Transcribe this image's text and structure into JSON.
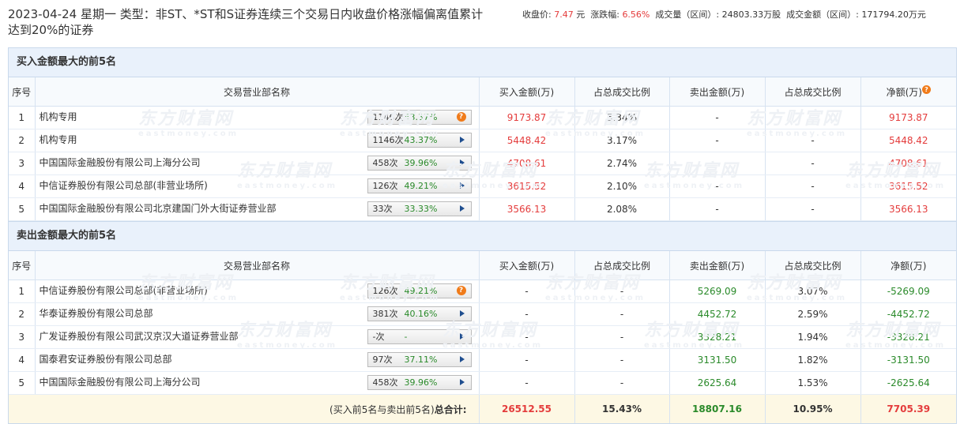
{
  "header": {
    "title": "2023-04-24 星期一 类型：非ST、*ST和S证券连续三个交易日内收盘价格涨幅偏离值累计达到20%的证券",
    "quote": {
      "close_label": "收盘价:",
      "close_value": "7.47",
      "close_unit": "元",
      "change_label": "涨跌幅:",
      "change_value": "6.56%",
      "volume_label": "成交量（区间）:",
      "volume_value": "24803.33万股",
      "amount_label": "成交金额（区间）:",
      "amount_value": "171794.20万元"
    }
  },
  "watermark": {
    "cn": "东方财富网",
    "en": "eastmoney.com"
  },
  "columns": [
    "序号",
    "交易营业部名称",
    "买入金额(万)",
    "占总成交比例",
    "卖出金额(万)",
    "占总成交比例",
    "净额(万)"
  ],
  "buy": {
    "title": "买入金额最大的前5名",
    "rows": [
      {
        "idx": "1",
        "name": "机构专用",
        "count": "1146次",
        "rate": "43.37%",
        "buy": "9173.87",
        "buy_pct": "5.34%",
        "sell": "-",
        "sell_pct": "-",
        "net": "9173.87"
      },
      {
        "idx": "2",
        "name": "机构专用",
        "count": "1146次",
        "rate": "43.37%",
        "buy": "5448.42",
        "buy_pct": "3.17%",
        "sell": "-",
        "sell_pct": "-",
        "net": "5448.42"
      },
      {
        "idx": "3",
        "name": "中国国际金融股份有限公司上海分公司",
        "count": "458次",
        "rate": "39.96%",
        "buy": "4708.61",
        "buy_pct": "2.74%",
        "sell": "-",
        "sell_pct": "-",
        "net": "4708.61"
      },
      {
        "idx": "4",
        "name": "中信证券股份有限公司总部(非营业场所)",
        "count": "126次",
        "rate": "49.21%",
        "buy": "3615.52",
        "buy_pct": "2.10%",
        "sell": "-",
        "sell_pct": "-",
        "net": "3615.52"
      },
      {
        "idx": "5",
        "name": "中国国际金融股份有限公司北京建国门外大街证券营业部",
        "count": "33次",
        "rate": "33.33%",
        "buy": "3566.13",
        "buy_pct": "2.08%",
        "sell": "-",
        "sell_pct": "-",
        "net": "3566.13"
      }
    ]
  },
  "sell": {
    "title": "卖出金额最大的前5名",
    "rows": [
      {
        "idx": "1",
        "name": "中信证券股份有限公司总部(非营业场所)",
        "count": "126次",
        "rate": "49.21%",
        "buy": "-",
        "buy_pct": "-",
        "sell": "5269.09",
        "sell_pct": "3.07%",
        "net": "-5269.09"
      },
      {
        "idx": "2",
        "name": "华泰证券股份有限公司总部",
        "count": "381次",
        "rate": "40.16%",
        "buy": "-",
        "buy_pct": "-",
        "sell": "4452.72",
        "sell_pct": "2.59%",
        "net": "-4452.72"
      },
      {
        "idx": "3",
        "name": "广发证券股份有限公司武汉京汉大道证券营业部",
        "count": "-次",
        "rate": "-",
        "buy": "-",
        "buy_pct": "-",
        "sell": "3328.21",
        "sell_pct": "1.94%",
        "net": "-3328.21"
      },
      {
        "idx": "4",
        "name": "国泰君安证券股份有限公司总部",
        "count": "97次",
        "rate": "37.11%",
        "buy": "-",
        "buy_pct": "-",
        "sell": "3131.50",
        "sell_pct": "1.82%",
        "net": "-3131.50"
      },
      {
        "idx": "5",
        "name": "中国国际金融股份有限公司上海分公司",
        "count": "458次",
        "rate": "39.96%",
        "buy": "-",
        "buy_pct": "-",
        "sell": "2625.64",
        "sell_pct": "1.53%",
        "net": "-2625.64"
      }
    ]
  },
  "total": {
    "label_prefix": "(买入前5名与卖出前5名)",
    "label_bold": "总合计:",
    "buy": "26512.55",
    "buy_pct": "15.43%",
    "sell": "18807.16",
    "sell_pct": "10.95%",
    "net": "7705.39"
  },
  "colors": {
    "up": "#e43c3c",
    "down": "#2a8a2a",
    "section_bg": "#e9f1fb",
    "total_bg": "#fdf8e4",
    "help_icon": "#f07b1a"
  }
}
